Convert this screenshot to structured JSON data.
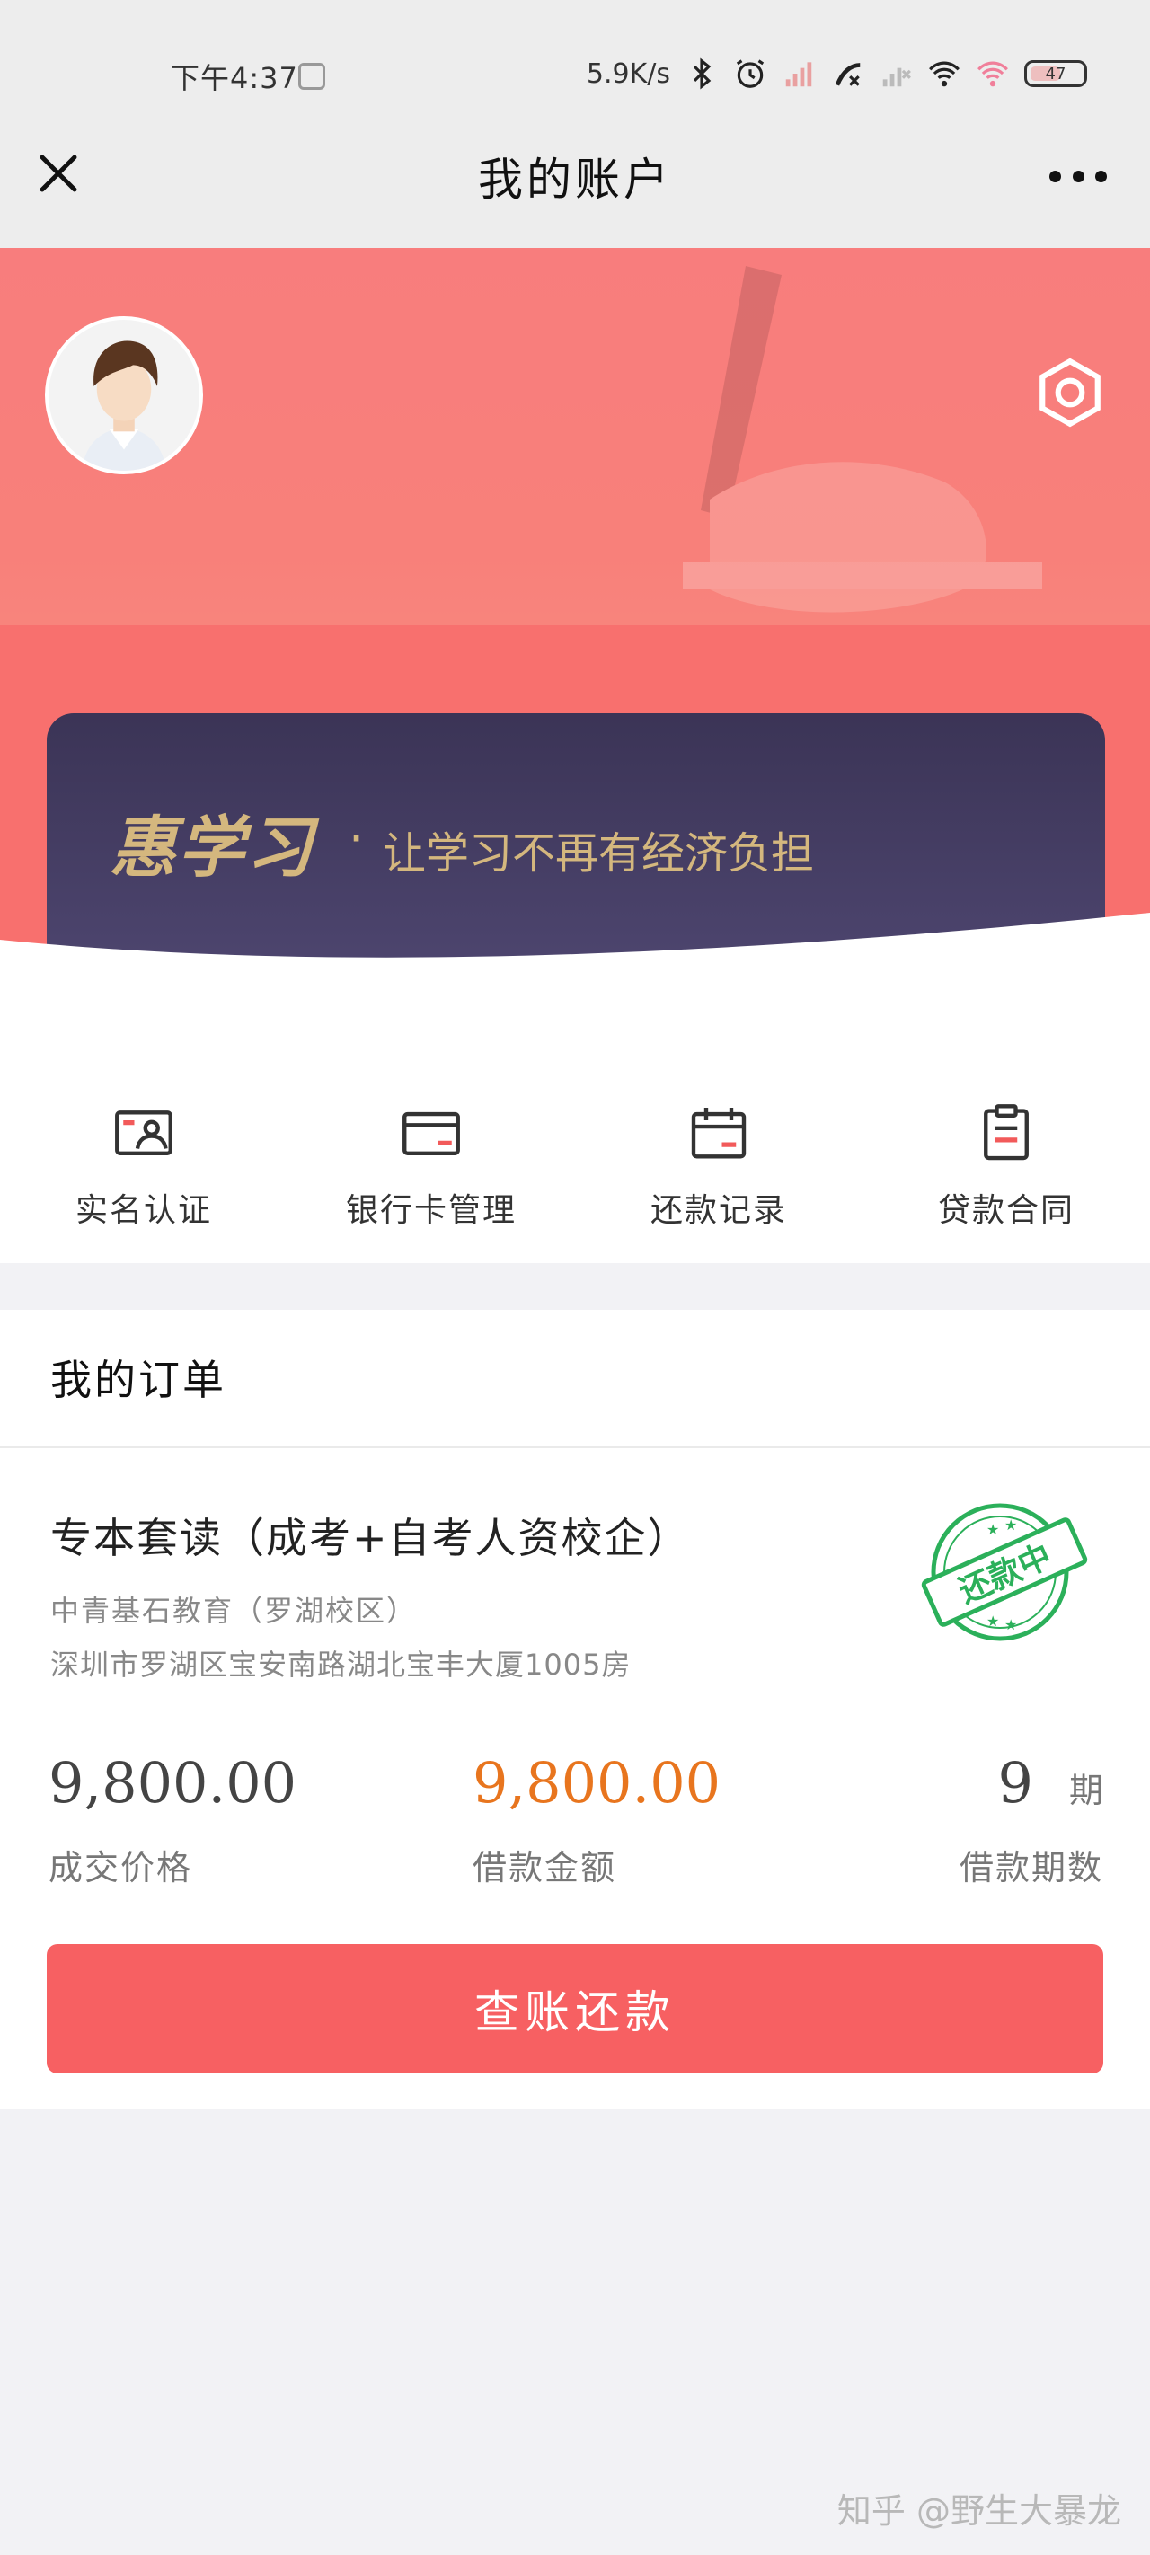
{
  "status_bar": {
    "time": "下午4:37",
    "net_speed": "5.9K/s",
    "battery": "47",
    "icons": [
      "notification-icon",
      "bluetooth-icon",
      "alarm-icon",
      "5g-signal-icon",
      "no-sim-icon",
      "wifi-icon",
      "hotspot-icon",
      "battery-icon"
    ]
  },
  "nav": {
    "title": "我的账户",
    "close_icon": "close-icon",
    "more_icon": "more-icon"
  },
  "hero": {
    "avatar_icon": "user-avatar",
    "settings_icon": "settings-icon",
    "brand": "惠学习",
    "dot": "·",
    "slogan": "让学习不再有经济负担"
  },
  "actions": [
    {
      "label": "实名认证",
      "icon": "id-card-icon"
    },
    {
      "label": "银行卡管理",
      "icon": "bank-card-icon"
    },
    {
      "label": "还款记录",
      "icon": "calendar-icon"
    },
    {
      "label": "贷款合同",
      "icon": "contract-icon"
    }
  ],
  "orders": {
    "title": "我的订单",
    "item": {
      "name": "专本套读（成考+自考人资校企）",
      "school": "中青基石教育（罗湖校区）",
      "address": "深圳市罗湖区宝安南路湖北宝丰大厦1005房",
      "stamp": "还款中",
      "deal_price": "9,800.00",
      "deal_price_label": "成交价格",
      "loan_amount": "9,800.00",
      "loan_amount_label": "借款金额",
      "installments": "9",
      "installments_unit": "期",
      "installments_label": "借款期数",
      "button": "查账还款"
    }
  },
  "colors": {
    "accent": "#f76062",
    "loan_amount": "#e8751e",
    "stamp": "#2bb05a",
    "promo_bg": "#3b3456",
    "promo_text": "#d4b77e"
  },
  "watermark": "知乎 @野生大暴龙"
}
